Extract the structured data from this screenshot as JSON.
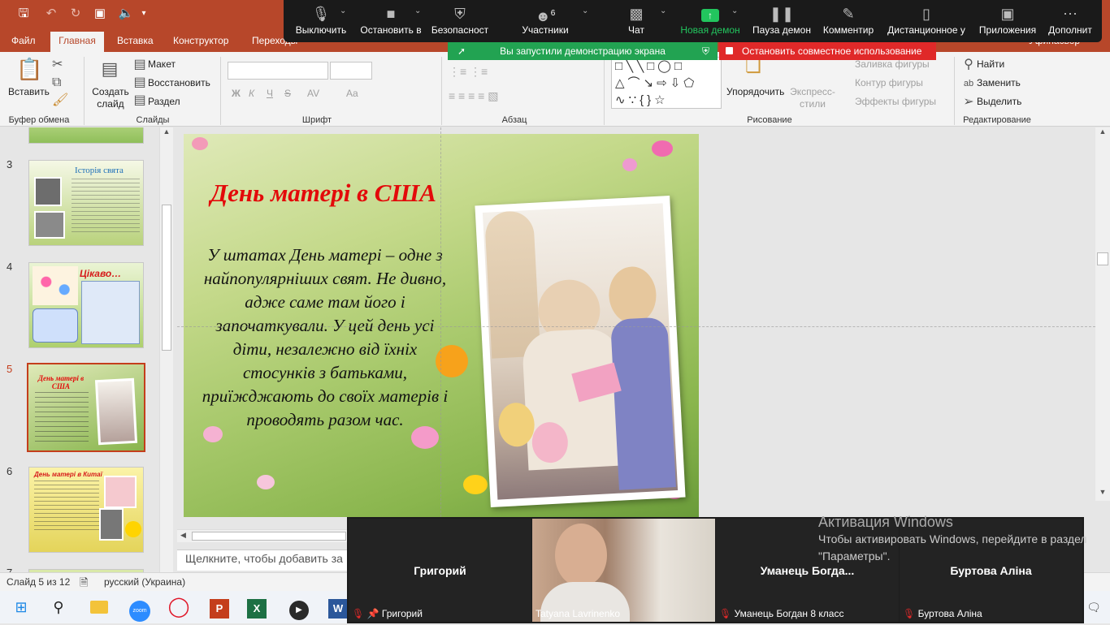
{
  "quick_access": {
    "save_icon": "save-icon",
    "undo_icon": "undo-icon",
    "redo_icon": "redo-icon",
    "present_icon": "start-presentation-icon",
    "audio_icon": "audio-icon"
  },
  "tabs": [
    "Файл",
    "Главная",
    "Вставка",
    "Конструктор",
    "Переходы"
  ],
  "active_tab": "Главная",
  "right_title": "Уфинасвор",
  "zoom": {
    "controls": [
      {
        "label": "Выключить",
        "icon": "microphone-icon"
      },
      {
        "label": "Остановить в",
        "icon": "video-camera-icon"
      },
      {
        "label": "Безопасност",
        "icon": "shield-icon"
      },
      {
        "label": "Участники",
        "icon": "participants-icon",
        "count": "6"
      },
      {
        "label": "Чат",
        "icon": "chat-icon"
      },
      {
        "label": "Новая демон",
        "icon": "share-screen-icon"
      },
      {
        "label": "Пауза демон",
        "icon": "pause-icon"
      },
      {
        "label": "Комментир",
        "icon": "pencil-icon"
      },
      {
        "label": "Дистанционное у",
        "icon": "mouse-icon"
      },
      {
        "label": "Приложения",
        "icon": "apps-icon"
      },
      {
        "label": "Дополнит",
        "icon": "more-icon"
      }
    ],
    "share_notice": "Вы запустили демонстрацию экрана",
    "stop_label": "Остановить совместное использование"
  },
  "ribbon": {
    "clipboard": {
      "paste": "Вставить",
      "group": "Буфер обмена"
    },
    "slides": {
      "new_slide": "Создать слайд",
      "layout": "Макет",
      "reset": "Восстановить",
      "section": "Раздел",
      "group": "Слайды"
    },
    "font": {
      "group": "Шрифт",
      "bold": "Ж",
      "italic": "К",
      "underline": "Ч",
      "strike": "S",
      "spacing": "AV",
      "case": "Aa"
    },
    "paragraph": {
      "group": "Абзац"
    },
    "drawing": {
      "arrange": "Упорядочить",
      "quick_styles": "Экспресс-стили",
      "fill": "Заливка фигуры",
      "outline": "Контур фигуры",
      "effects": "Эффекты фигуры",
      "group": "Рисование"
    },
    "editing": {
      "find": "Найти",
      "replace": "Заменить",
      "select": "Выделить",
      "group": "Редактирование"
    }
  },
  "thumbnails": [
    {
      "num": "3",
      "title": "Історія свята"
    },
    {
      "num": "4",
      "title": "Цікаво…"
    },
    {
      "num": "5",
      "title": "День матері в США",
      "selected": true
    },
    {
      "num": "6",
      "title": "День матері в Китаї"
    },
    {
      "num": "7",
      "title": ""
    }
  ],
  "slide": {
    "title": "День матері в США",
    "body": "У штатах День матері – одне з найпопулярніших свят. Не дивно, адже саме там його і започаткували. У цей день усі діти, незалежно від їхніх стосунків з батьками, приїжджають до своїх матерів і проводять разом час."
  },
  "notes_placeholder": "Щелкните, чтобы добавить за",
  "status": {
    "slide": "Слайд 5 из 12",
    "language": "русский (Украина)"
  },
  "participants": [
    {
      "name": "Григорий",
      "label": "Григорий",
      "video": false
    },
    {
      "name": "",
      "label": "Tatyana Lavrinenko",
      "video": true
    },
    {
      "name": "Уманець  Богда...",
      "label": "Уманець Богдан 8 класс",
      "video": false
    },
    {
      "name": "Буртова Аліна",
      "label": "Буртова Аліна",
      "video": false
    }
  ],
  "activation": {
    "title": "Активация Windows",
    "text": "Чтобы активировать Windows, перейдите в раздел \"Параметры\"."
  },
  "taskbar": [
    "windows-start-icon",
    "search-icon",
    "file-explorer-icon",
    "zoom-app-icon",
    "opera-icon",
    "powerpoint-icon",
    "excel-icon",
    "media-player-icon",
    "word-icon"
  ]
}
